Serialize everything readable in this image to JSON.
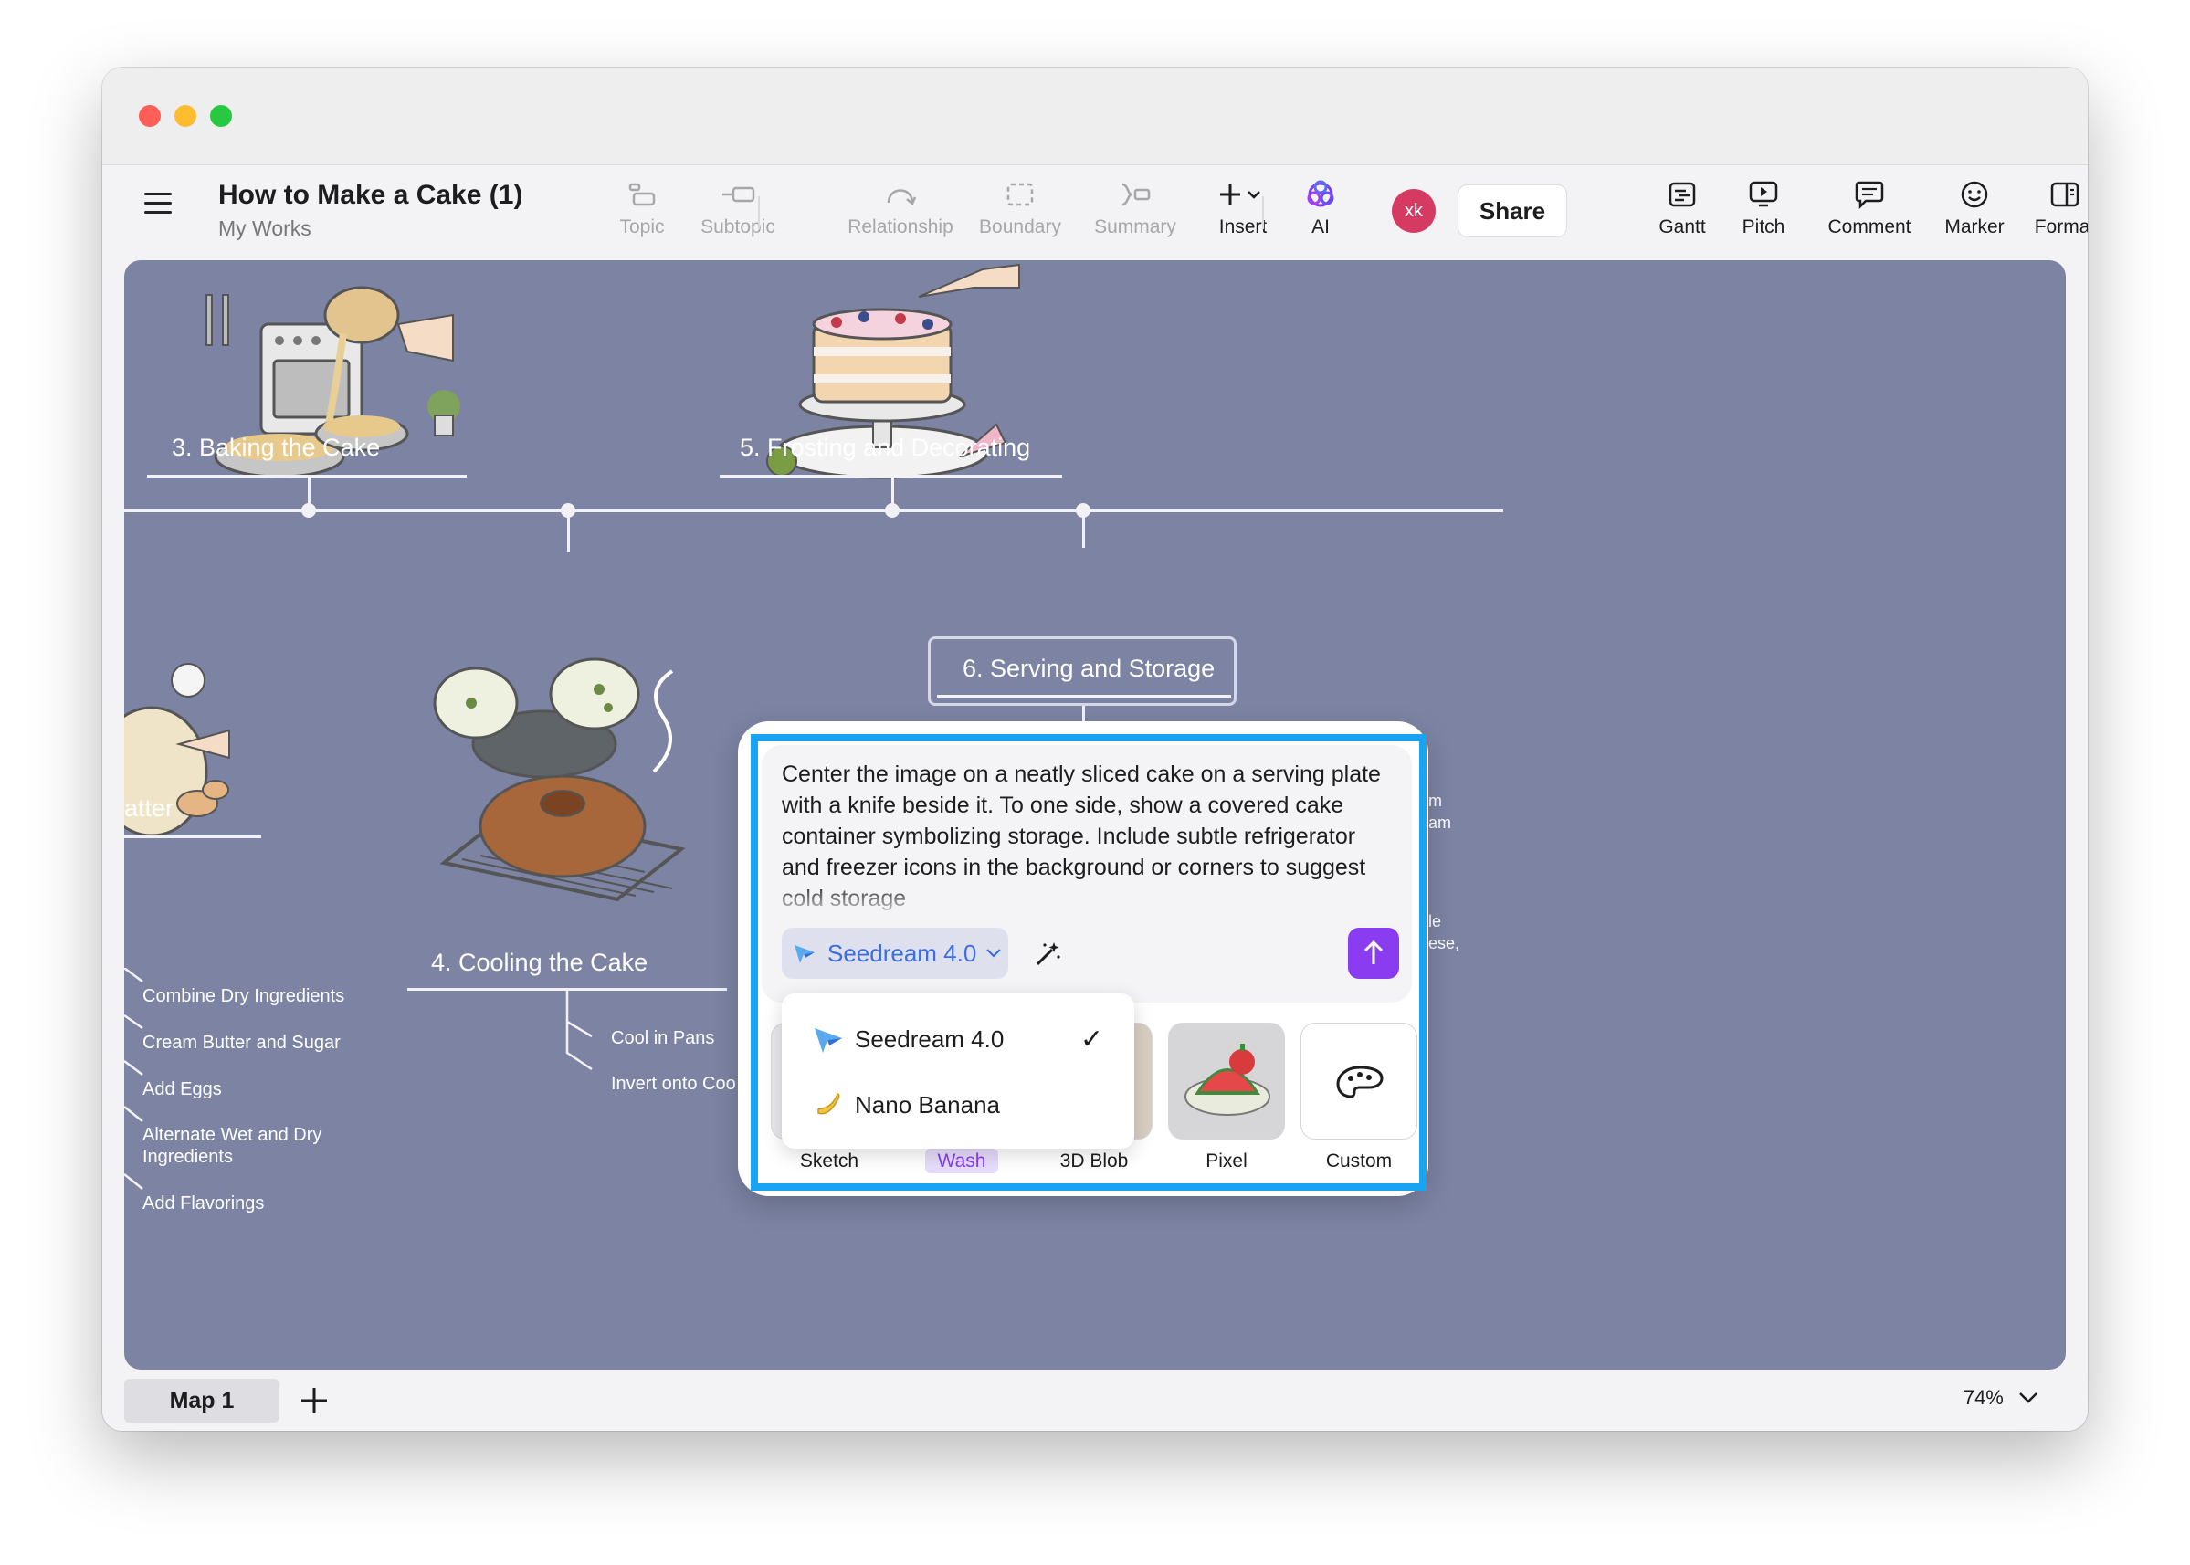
{
  "document": {
    "title": "How to Make a Cake (1)",
    "subtitle": "My Works"
  },
  "toolbar": {
    "topic": "Topic",
    "subtopic": "Subtopic",
    "relationship": "Relationship",
    "boundary": "Boundary",
    "summary": "Summary",
    "insert": "Insert",
    "ai": "AI",
    "avatar_initials": "xk",
    "share": "Share",
    "gantt": "Gantt",
    "pitch": "Pitch",
    "comment": "Comment",
    "marker": "Marker",
    "format": "Format"
  },
  "map": {
    "topics": {
      "baking": "3. Baking the Cake",
      "frosting": "5. Frosting and Decorating",
      "serving": "6. Serving and Storage",
      "batter": "atter",
      "cooling": "4. Cooling the Cake"
    },
    "batter_subtopics": [
      "Combine Dry Ingredients",
      "Cream Butter and Sugar",
      "Add Eggs",
      "Alternate Wet and Dry",
      "Ingredients",
      "Add Flavorings"
    ],
    "cooling_subtopics": [
      "Cool in Pans",
      "Invert onto Coo"
    ],
    "serving_fragments": [
      "om",
      "eam",
      ",",
      "ble",
      "eese,"
    ]
  },
  "ai_panel": {
    "prompt": "Center the image on a neatly sliced cake on a serving plate with a knife beside it. To one side, show a covered cake container symbolizing storage. Include subtle refrigerator and freezer icons in the background or corners to suggest cold storage",
    "selected_model": "Seedream 4.0",
    "models": [
      {
        "name": "Seedream 4.0",
        "selected": true,
        "icon": "seedream-icon"
      },
      {
        "name": "Nano Banana",
        "selected": false,
        "icon": "banana-icon"
      }
    ],
    "check_mark": "✓",
    "styles": [
      "Sketch",
      "Wash",
      "3D Blob",
      "Pixel",
      "Custom"
    ],
    "active_style": "Wash"
  },
  "bottom": {
    "map_tab": "Map 1",
    "zoom": "74%"
  },
  "colors": {
    "canvas": "#7c83a3",
    "accent_purple": "#8a3cf0",
    "highlight_blue": "#1aa3f0",
    "model_blue": "#3b6ee0"
  }
}
